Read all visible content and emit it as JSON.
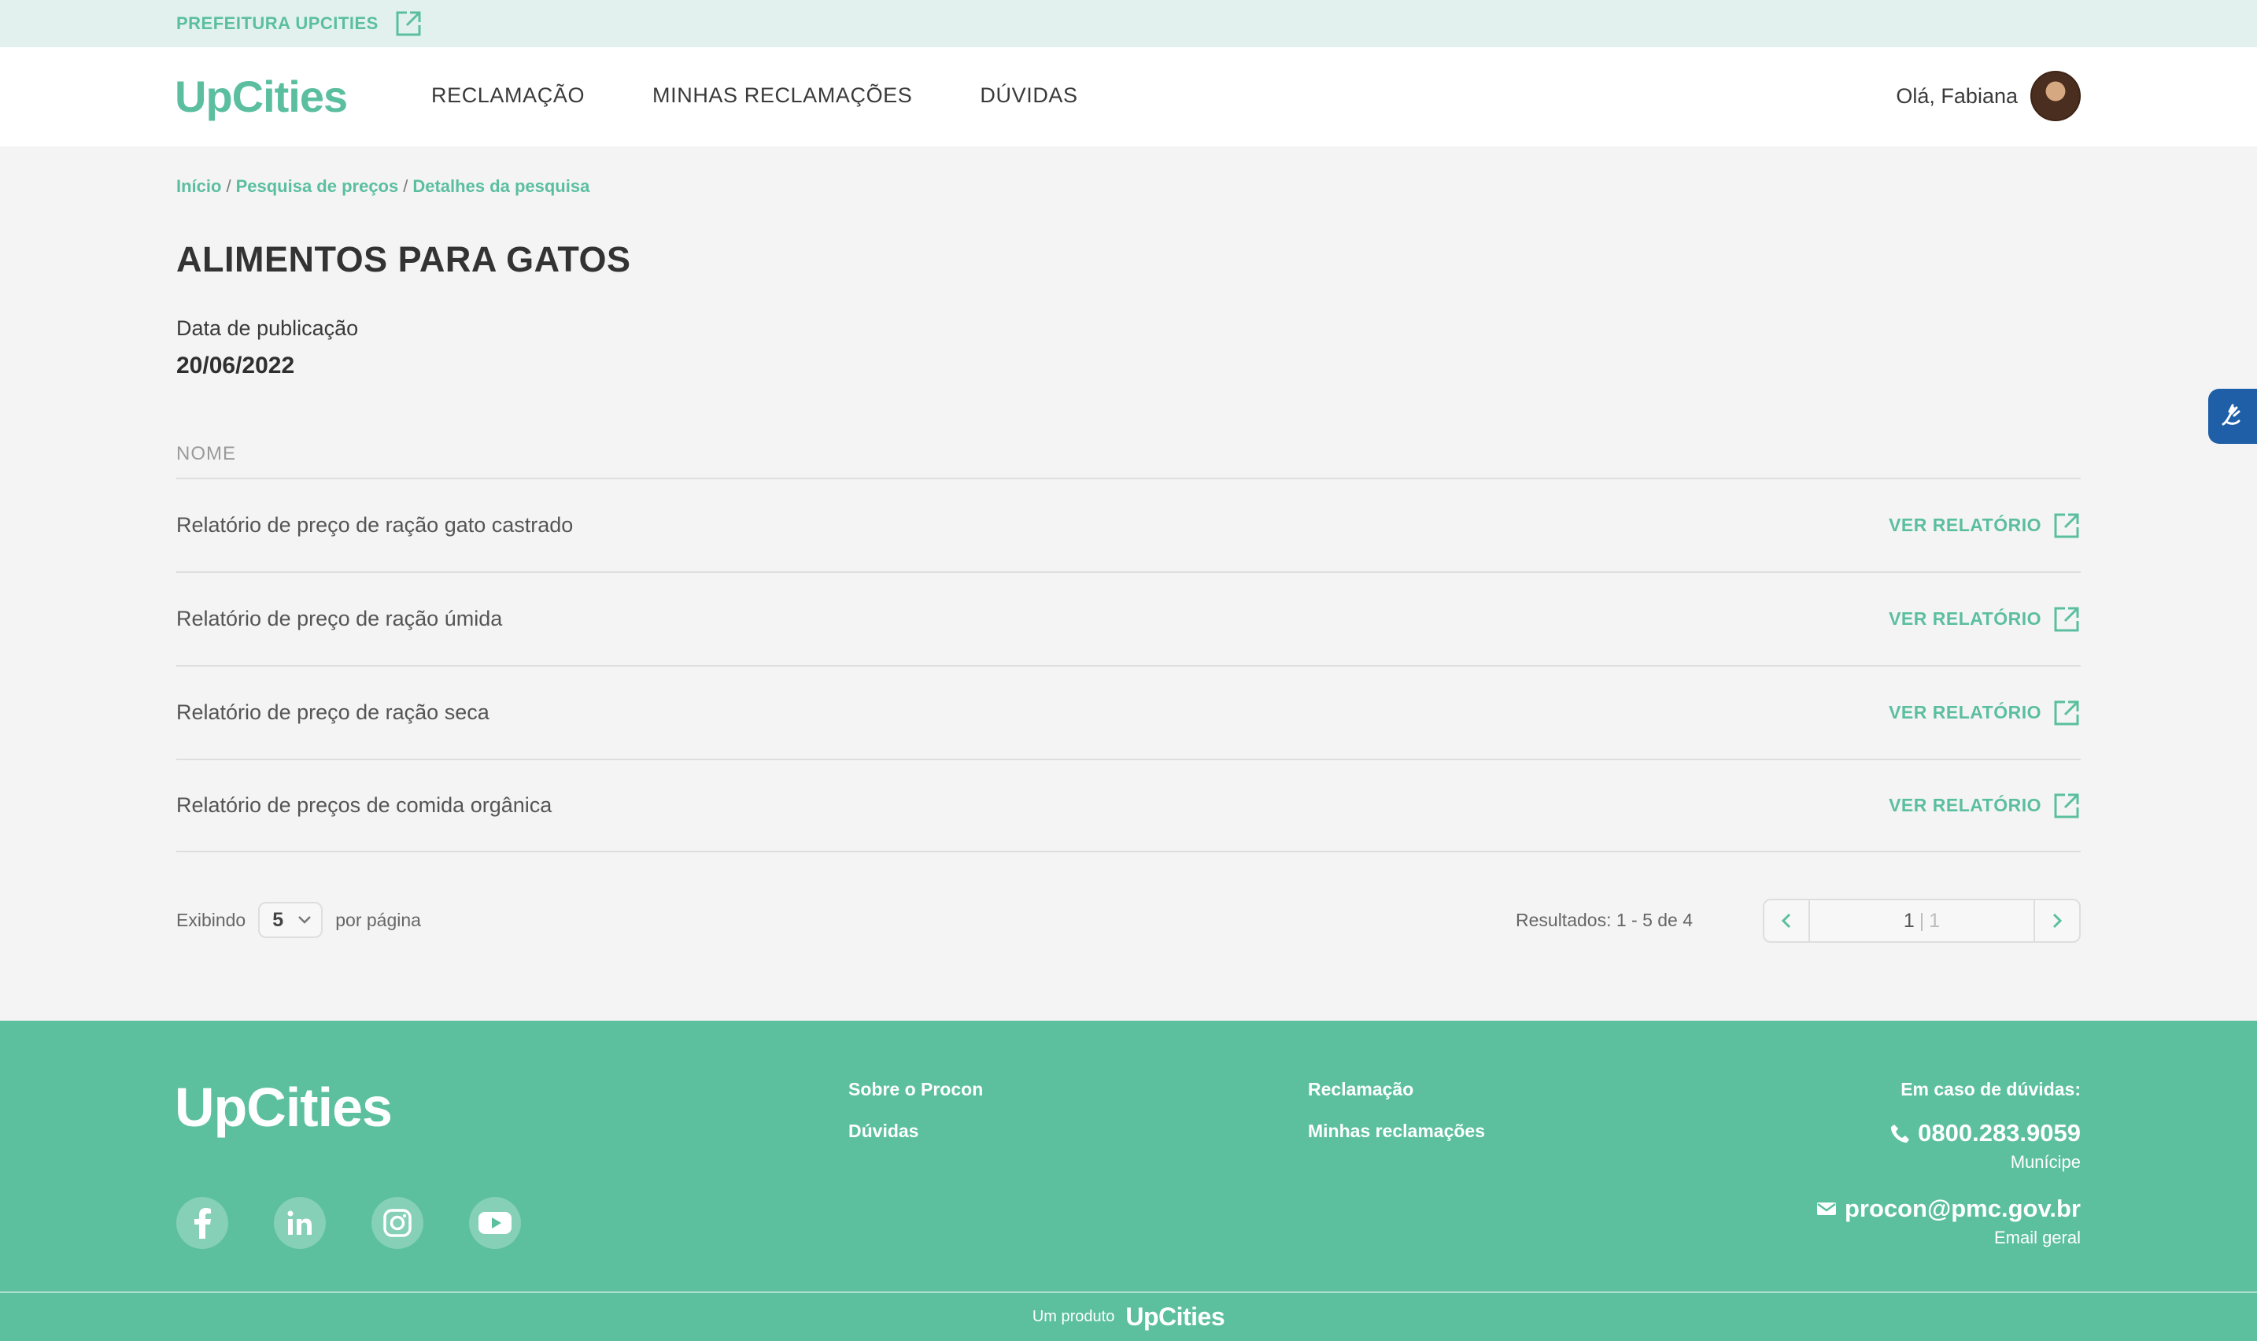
{
  "topbar": {
    "link_label": "PREFEITURA UPCITIES"
  },
  "header": {
    "logo": "UpCities",
    "nav": [
      "RECLAMAÇÃO",
      "MINHAS RECLAMAÇÕES",
      "DÚVIDAS"
    ],
    "greeting": "Olá, Fabiana"
  },
  "breadcrumb": [
    "Início",
    "Pesquisa de preços",
    "Detalhes da pesquisa"
  ],
  "page": {
    "title": "ALIMENTOS PARA GATOS",
    "pub_label": "Data de publicação",
    "pub_date": "20/06/2022",
    "column_header": "NOME"
  },
  "rows": [
    {
      "name": "Relatório de preço de ração gato castrado",
      "action": "VER RELATÓRIO"
    },
    {
      "name": "Relatório de preço de ração úmida",
      "action": "VER RELATÓRIO"
    },
    {
      "name": "Relatório de preço de ração seca",
      "action": "VER RELATÓRIO"
    },
    {
      "name": "Relatório de preços de comida orgânica",
      "action": "VER RELATÓRIO"
    }
  ],
  "pagination": {
    "showing_label": "Exibindo",
    "per_page_value": "5",
    "per_page_label": "por página",
    "results": "Resultados: 1 - 5 de 4",
    "current_page": "1",
    "separator": "|",
    "total_pages": "1"
  },
  "footer": {
    "logo": "UpCities",
    "col1": [
      "Sobre o Procon",
      "Dúvidas"
    ],
    "col2": [
      "Reclamação",
      "Minhas reclamações"
    ],
    "question": "Em caso de dúvidas:",
    "phone": "0800.283.9059",
    "phone_sub": "Munícipe",
    "email": "procon@pmc.gov.br",
    "email_sub": "Email geral",
    "product_label": "Um produto",
    "product_logo": "UpCities"
  },
  "colors": {
    "accent": "#5bbf9f",
    "footer_bg": "#5cc09f",
    "a11y_bg": "#1e5fa8"
  },
  "icons": [
    "external-link-icon",
    "chevron-down-icon",
    "chevron-left-icon",
    "chevron-right-icon",
    "facebook-icon",
    "linkedin-icon",
    "instagram-icon",
    "youtube-icon",
    "phone-icon",
    "mail-icon",
    "sign-language-icon"
  ]
}
